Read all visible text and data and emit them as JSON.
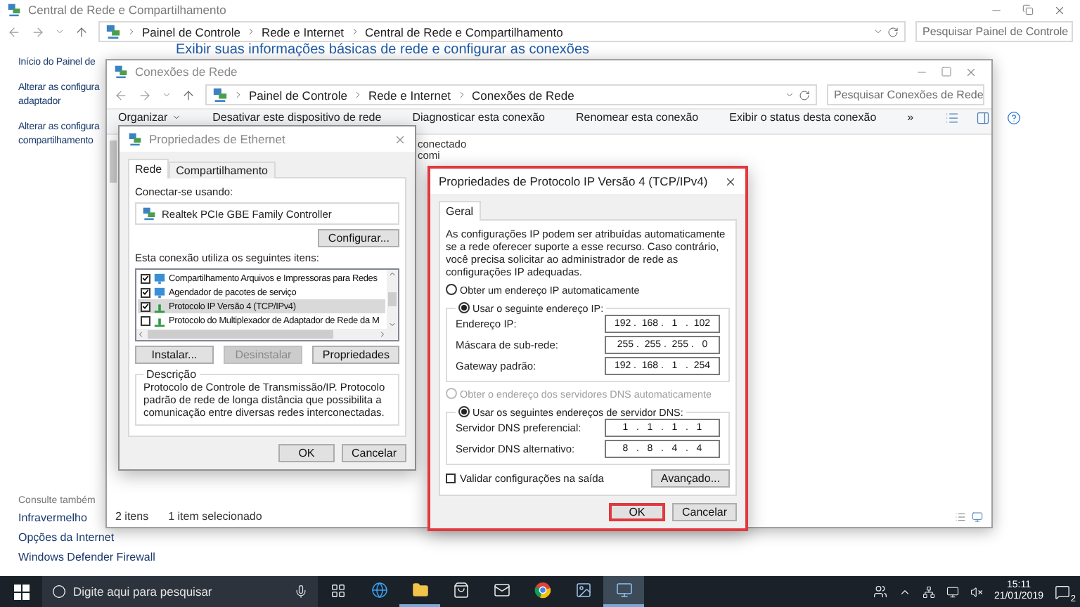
{
  "main_window": {
    "title": "Central de Rede e Compartilhamento",
    "breadcrumb": [
      "Painel de Controle",
      "Rede e Internet",
      "Central de Rede e Compartilhamento"
    ],
    "search": {
      "placeholder": "Pesquisar Painel de Controle"
    },
    "sidebar_links": [
      {
        "lines": [
          "Início do Painel de"
        ]
      },
      {
        "lines": [
          "Alterar as configura",
          "adaptador"
        ]
      },
      {
        "lines": [
          "Alterar as configura",
          "compartilhamento"
        ]
      }
    ],
    "heading": "Exibir suas informações básicas de rede e configurar as conexões",
    "see_also": {
      "title": "Consulte também",
      "links": [
        "Infravermelho",
        "Opções da Internet",
        "Windows Defender Firewall"
      ]
    }
  },
  "connections_window": {
    "title": "Conexões de Rede",
    "breadcrumb": [
      "Painel de Controle",
      "Rede e Internet",
      "Conexões de Rede"
    ],
    "search": {
      "placeholder": "Pesquisar Conexões de Rede"
    },
    "toolbar": [
      {
        "label": "Organizar",
        "menu": true
      },
      {
        "label": "Desativar este dispositivo de rede",
        "menu": false
      },
      {
        "label": "Diagnosticar esta conexão",
        "menu": false
      },
      {
        "label": "Renomear esta conexão",
        "menu": false
      },
      {
        "label": "Exibir o status desta conexão",
        "menu": false
      },
      {
        "label": "»",
        "menu": false
      }
    ],
    "content_texts": [
      "conectado",
      "comi"
    ],
    "status_bar": [
      "2 itens",
      "1 item selecionado"
    ]
  },
  "ethernet_dialog": {
    "title": "Propriedades de Ethernet",
    "active": false,
    "tabs": [
      {
        "label": "Rede",
        "selected": true
      },
      {
        "label": "Compartilhamento",
        "selected": false
      }
    ],
    "connect_label": "Conectar-se usando:",
    "adapter": "Realtek PCIe GBE Family Controller",
    "configure_button": "Configurar...",
    "items_label": "Esta conexão utiliza os seguintes itens:",
    "items": [
      {
        "kind": "client",
        "label": "Compartilhamento Arquivos e Impressoras para Redes",
        "checked": true,
        "selected": false
      },
      {
        "kind": "client",
        "label": "Agendador de pacotes de serviço",
        "checked": true,
        "selected": false
      },
      {
        "kind": "protocol",
        "label": "Protocolo IP Versão 4 (TCP/IPv4)",
        "checked": true,
        "selected": true
      },
      {
        "kind": "protocol",
        "label": "Protocolo do Multiplexador de Adaptador de Rede da M",
        "checked": false,
        "selected": false
      }
    ],
    "buttons": [
      {
        "label": "Instalar...",
        "disabled": false
      },
      {
        "label": "Desinstalar",
        "disabled": true
      },
      {
        "label": "Propriedades",
        "disabled": false
      }
    ],
    "description": {
      "title": "Descrição",
      "text": "Protocolo de Controle de Transmissão/IP. Protocolo padrão de rede de longa distância que possibilita a comunicação entre diversas redes interconectadas."
    },
    "footer_buttons": [
      "OK",
      "Cancelar"
    ]
  },
  "ipv4_dialog": {
    "title": "Propriedades de Protocolo IP Versão 4 (TCP/IPv4)",
    "active": true,
    "highlighted": true,
    "tabs": [
      {
        "label": "Geral",
        "selected": true
      }
    ],
    "intro": "As configurações IP podem ser atribuídas automaticamente se a rede oferecer suporte a esse recurso. Caso contrário, você precisa solicitar ao administrador de rede as configurações IP adequadas.",
    "ip_mode": [
      {
        "label": "Obter um endereço IP automaticamente",
        "selected": false,
        "disabled": false
      },
      {
        "label": "Usar o seguinte endereço IP:",
        "selected": true,
        "disabled": false
      }
    ],
    "ip_fields": [
      {
        "label": "Endereço IP:",
        "value": "192 .  168 .   1   .  102"
      },
      {
        "label": "Máscara de sub-rede:",
        "value": "255 .  255 .  255 .   0"
      },
      {
        "label": "Gateway padrão:",
        "value": "192 .  168 .   1   .  254"
      }
    ],
    "dns_mode": [
      {
        "label": "Obter o endereço dos servidores DNS automaticamente",
        "selected": false,
        "disabled": true
      },
      {
        "label": "Usar os seguintes endereços de servidor DNS:",
        "selected": true,
        "disabled": false
      }
    ],
    "dns_fields": [
      {
        "label": "Servidor DNS preferencial:",
        "value": "1   .   1   .   1   .   1"
      },
      {
        "label": "Servidor DNS alternativo:",
        "value": "8   .   8   .   4   .   4"
      }
    ],
    "validate": {
      "label": "Validar configurações na saída",
      "checked": false
    },
    "advanced_button": "Avançado...",
    "footer_buttons": [
      {
        "label": "OK",
        "highlighted": true
      },
      {
        "label": "Cancelar",
        "highlighted": false
      }
    ]
  },
  "taskbar": {
    "search": {
      "placeholder": "Digite aqui para pesquisar"
    },
    "apps": [
      {
        "kind": "task-view",
        "running": false,
        "active": false
      },
      {
        "kind": "globe",
        "running": false,
        "active": false
      },
      {
        "kind": "folder",
        "running": true,
        "active": false
      },
      {
        "kind": "store",
        "running": false,
        "active": false
      },
      {
        "kind": "mail",
        "running": false,
        "active": false
      },
      {
        "kind": "round-browser",
        "running": false,
        "active": false
      },
      {
        "kind": "image",
        "running": false,
        "active": false
      },
      {
        "kind": "monitor",
        "running": true,
        "active": true
      }
    ],
    "clock": {
      "time": "15:11",
      "date": "21/01/2019"
    },
    "notifications": "2"
  }
}
